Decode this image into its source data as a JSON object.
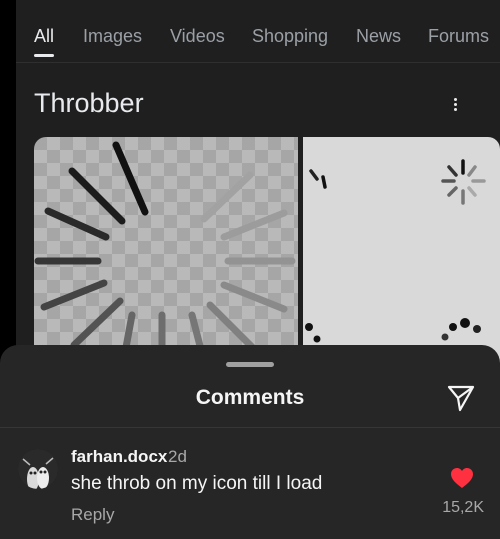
{
  "tabs": [
    {
      "label": "All",
      "active": true
    },
    {
      "label": "Images"
    },
    {
      "label": "Videos"
    },
    {
      "label": "Shopping"
    },
    {
      "label": "News"
    },
    {
      "label": "Forums"
    }
  ],
  "results": {
    "title": "Throbber",
    "menu_icon": "more-vertical-icon"
  },
  "comments_sheet": {
    "title": "Comments",
    "share_icon": "send-icon",
    "comment": {
      "username": "farhan.docx",
      "time": "2d",
      "text": "she throb on my icon till I load",
      "reply_label": "Reply",
      "likes": "15,2K",
      "liked": true
    }
  },
  "colors": {
    "heart": "#ff3040",
    "sheet_background": "#262626"
  }
}
